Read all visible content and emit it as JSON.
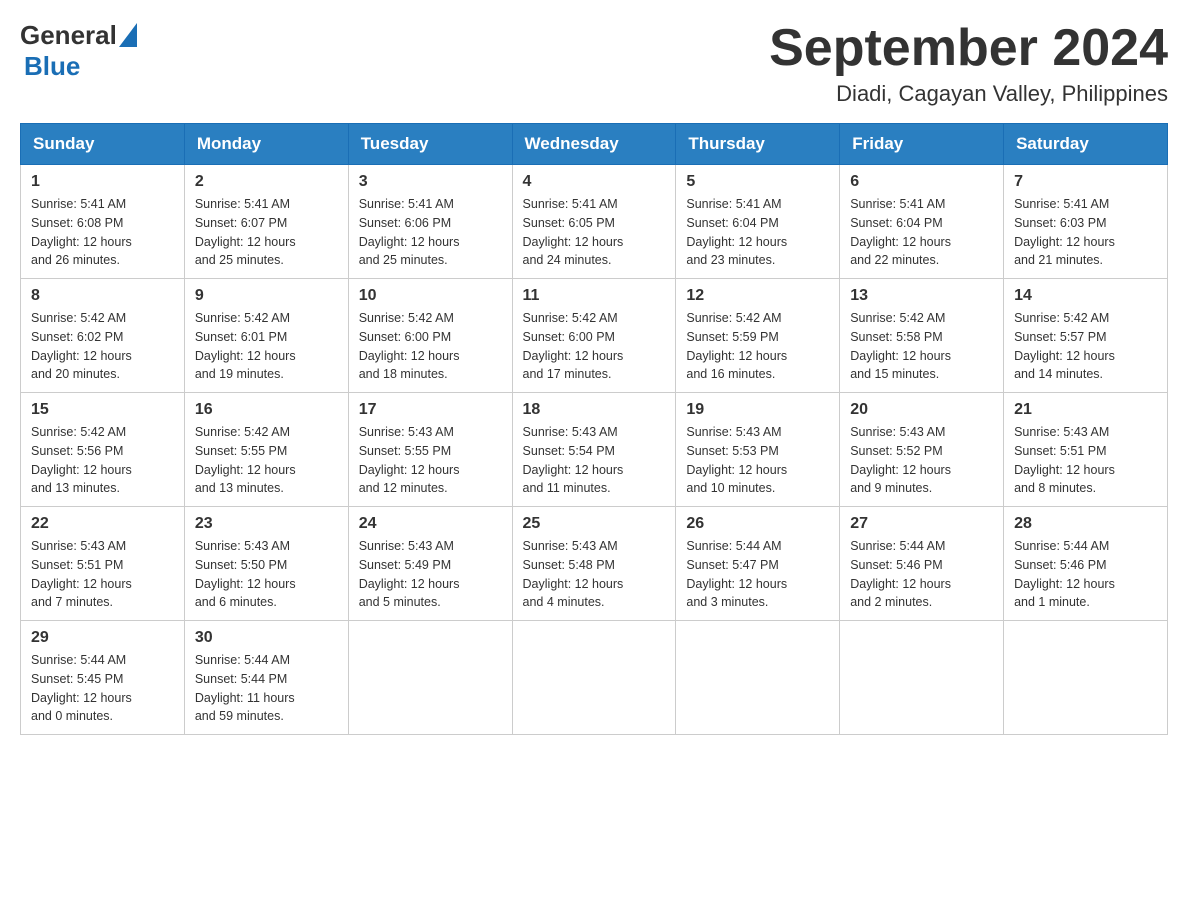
{
  "header": {
    "logo_general": "General",
    "logo_blue": "Blue",
    "month_title": "September 2024",
    "location": "Diadi, Cagayan Valley, Philippines"
  },
  "weekdays": [
    "Sunday",
    "Monday",
    "Tuesday",
    "Wednesday",
    "Thursday",
    "Friday",
    "Saturday"
  ],
  "weeks": [
    [
      {
        "day": "1",
        "sunrise": "5:41 AM",
        "sunset": "6:08 PM",
        "daylight": "12 hours and 26 minutes."
      },
      {
        "day": "2",
        "sunrise": "5:41 AM",
        "sunset": "6:07 PM",
        "daylight": "12 hours and 25 minutes."
      },
      {
        "day": "3",
        "sunrise": "5:41 AM",
        "sunset": "6:06 PM",
        "daylight": "12 hours and 25 minutes."
      },
      {
        "day": "4",
        "sunrise": "5:41 AM",
        "sunset": "6:05 PM",
        "daylight": "12 hours and 24 minutes."
      },
      {
        "day": "5",
        "sunrise": "5:41 AM",
        "sunset": "6:04 PM",
        "daylight": "12 hours and 23 minutes."
      },
      {
        "day": "6",
        "sunrise": "5:41 AM",
        "sunset": "6:04 PM",
        "daylight": "12 hours and 22 minutes."
      },
      {
        "day": "7",
        "sunrise": "5:41 AM",
        "sunset": "6:03 PM",
        "daylight": "12 hours and 21 minutes."
      }
    ],
    [
      {
        "day": "8",
        "sunrise": "5:42 AM",
        "sunset": "6:02 PM",
        "daylight": "12 hours and 20 minutes."
      },
      {
        "day": "9",
        "sunrise": "5:42 AM",
        "sunset": "6:01 PM",
        "daylight": "12 hours and 19 minutes."
      },
      {
        "day": "10",
        "sunrise": "5:42 AM",
        "sunset": "6:00 PM",
        "daylight": "12 hours and 18 minutes."
      },
      {
        "day": "11",
        "sunrise": "5:42 AM",
        "sunset": "6:00 PM",
        "daylight": "12 hours and 17 minutes."
      },
      {
        "day": "12",
        "sunrise": "5:42 AM",
        "sunset": "5:59 PM",
        "daylight": "12 hours and 16 minutes."
      },
      {
        "day": "13",
        "sunrise": "5:42 AM",
        "sunset": "5:58 PM",
        "daylight": "12 hours and 15 minutes."
      },
      {
        "day": "14",
        "sunrise": "5:42 AM",
        "sunset": "5:57 PM",
        "daylight": "12 hours and 14 minutes."
      }
    ],
    [
      {
        "day": "15",
        "sunrise": "5:42 AM",
        "sunset": "5:56 PM",
        "daylight": "12 hours and 13 minutes."
      },
      {
        "day": "16",
        "sunrise": "5:42 AM",
        "sunset": "5:55 PM",
        "daylight": "12 hours and 13 minutes."
      },
      {
        "day": "17",
        "sunrise": "5:43 AM",
        "sunset": "5:55 PM",
        "daylight": "12 hours and 12 minutes."
      },
      {
        "day": "18",
        "sunrise": "5:43 AM",
        "sunset": "5:54 PM",
        "daylight": "12 hours and 11 minutes."
      },
      {
        "day": "19",
        "sunrise": "5:43 AM",
        "sunset": "5:53 PM",
        "daylight": "12 hours and 10 minutes."
      },
      {
        "day": "20",
        "sunrise": "5:43 AM",
        "sunset": "5:52 PM",
        "daylight": "12 hours and 9 minutes."
      },
      {
        "day": "21",
        "sunrise": "5:43 AM",
        "sunset": "5:51 PM",
        "daylight": "12 hours and 8 minutes."
      }
    ],
    [
      {
        "day": "22",
        "sunrise": "5:43 AM",
        "sunset": "5:51 PM",
        "daylight": "12 hours and 7 minutes."
      },
      {
        "day": "23",
        "sunrise": "5:43 AM",
        "sunset": "5:50 PM",
        "daylight": "12 hours and 6 minutes."
      },
      {
        "day": "24",
        "sunrise": "5:43 AM",
        "sunset": "5:49 PM",
        "daylight": "12 hours and 5 minutes."
      },
      {
        "day": "25",
        "sunrise": "5:43 AM",
        "sunset": "5:48 PM",
        "daylight": "12 hours and 4 minutes."
      },
      {
        "day": "26",
        "sunrise": "5:44 AM",
        "sunset": "5:47 PM",
        "daylight": "12 hours and 3 minutes."
      },
      {
        "day": "27",
        "sunrise": "5:44 AM",
        "sunset": "5:46 PM",
        "daylight": "12 hours and 2 minutes."
      },
      {
        "day": "28",
        "sunrise": "5:44 AM",
        "sunset": "5:46 PM",
        "daylight": "12 hours and 1 minute."
      }
    ],
    [
      {
        "day": "29",
        "sunrise": "5:44 AM",
        "sunset": "5:45 PM",
        "daylight": "12 hours and 0 minutes."
      },
      {
        "day": "30",
        "sunrise": "5:44 AM",
        "sunset": "5:44 PM",
        "daylight": "11 hours and 59 minutes."
      },
      null,
      null,
      null,
      null,
      null
    ]
  ],
  "labels": {
    "sunrise": "Sunrise:",
    "sunset": "Sunset:",
    "daylight": "Daylight:"
  }
}
